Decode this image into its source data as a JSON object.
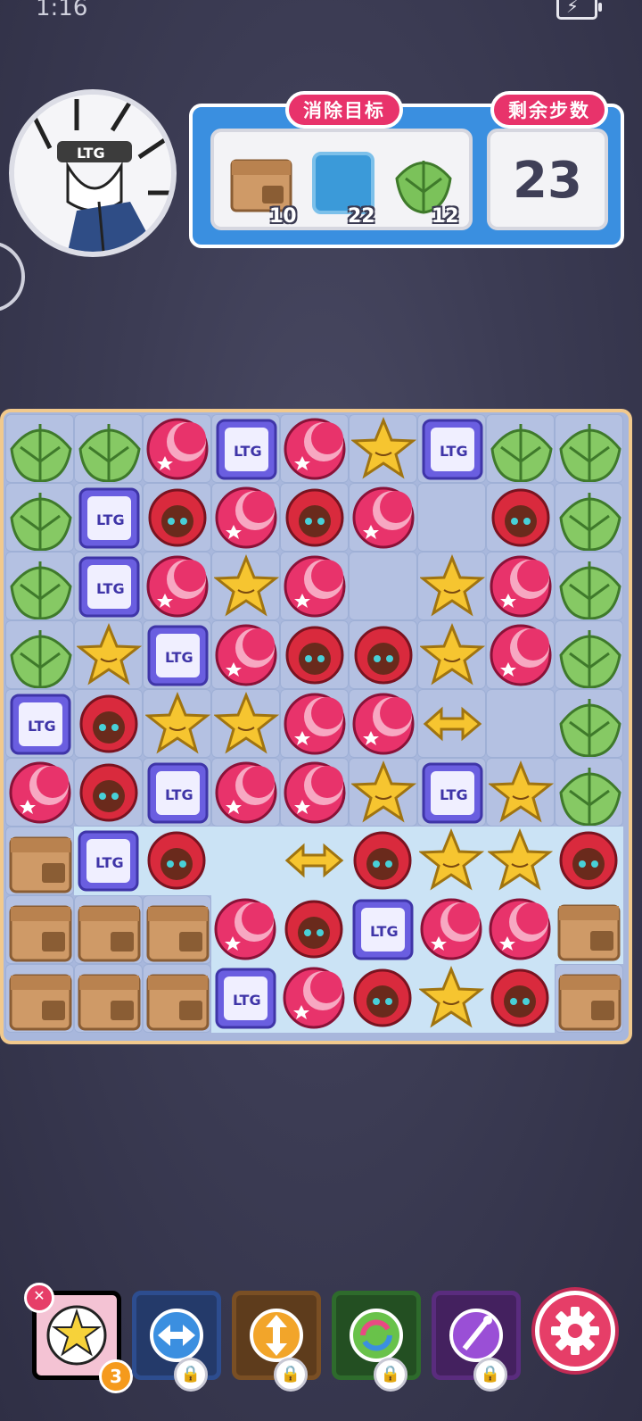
{
  "status_bar": {
    "time": "1:16"
  },
  "goals": {
    "title": "消除目标",
    "items": [
      {
        "name": "box",
        "count": "10"
      },
      {
        "name": "ice",
        "count": "22"
      },
      {
        "name": "leaf",
        "count": "12"
      }
    ]
  },
  "steps": {
    "title": "剩余步数",
    "value": "23"
  },
  "board": {
    "cols": 9,
    "rows": 9,
    "legend": "B=box L=leaf W=purple-block R=red-ball S=star M=moon A=arrow .=empty",
    "grid": [
      "LLMWMSWLL",
      "LWRMRM.RL",
      "LWMSM.SML",
      "LSWMRRSML",
      "WRSSMMA.L",
      "MRWMMSWSL",
      "BWR.ARSSR",
      "BBBMRWMMB",
      "BBBWMRSRB"
    ],
    "ice": [
      "000000000",
      "000000000",
      "000000000",
      "000000000",
      "000000000",
      "000000000",
      "011111111",
      "000111111",
      "000111110"
    ]
  },
  "toolbar": {
    "first_tool_badge": "3",
    "tools": [
      {
        "name": "character-card",
        "color": "#e84a83",
        "locked": false
      },
      {
        "name": "swap-tool",
        "color": "#2d4d8f",
        "locked": true
      },
      {
        "name": "vertical-tool",
        "color": "#7a4f24",
        "locked": true
      },
      {
        "name": "refresh-tool",
        "color": "#2e6b2c",
        "locked": true
      },
      {
        "name": "magic-tool",
        "color": "#5a2c7e",
        "locked": true
      }
    ]
  },
  "colors": {
    "accent": "#e8336b",
    "panel": "#3a8fe0"
  }
}
